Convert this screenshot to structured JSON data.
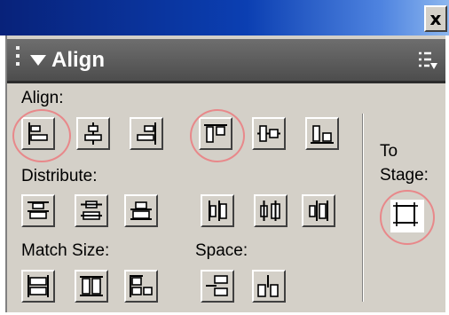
{
  "window": {
    "close_glyph": "x"
  },
  "panel": {
    "title": "Align",
    "collapse_icon": "triangle-down-icon",
    "options_icon": "options-menu-icon"
  },
  "sections": {
    "align": {
      "label": "Align:",
      "buttons": [
        "align-left",
        "align-horizontal-center",
        "align-right",
        "align-top",
        "align-vertical-center",
        "align-bottom"
      ]
    },
    "distribute": {
      "label": "Distribute:",
      "buttons": [
        "distribute-top-edge",
        "distribute-vertical-center",
        "distribute-bottom-edge",
        "distribute-left-edge",
        "distribute-horizontal-center",
        "distribute-right-edge"
      ]
    },
    "match_size": {
      "label": "Match Size:",
      "buttons": [
        "match-width",
        "match-height",
        "match-width-and-height"
      ]
    },
    "space": {
      "label": "Space:",
      "buttons": [
        "space-evenly-vertically",
        "space-evenly-horizontally"
      ]
    },
    "to_stage": {
      "label_line1": "To",
      "label_line2": "Stage:",
      "button": "to-stage-toggle",
      "state": "on"
    }
  },
  "highlight_color": "#e8888a",
  "colors": {
    "panel": "#d4d0c8",
    "header": "#5a5a5a",
    "titlebar": "#0b3fb2"
  }
}
